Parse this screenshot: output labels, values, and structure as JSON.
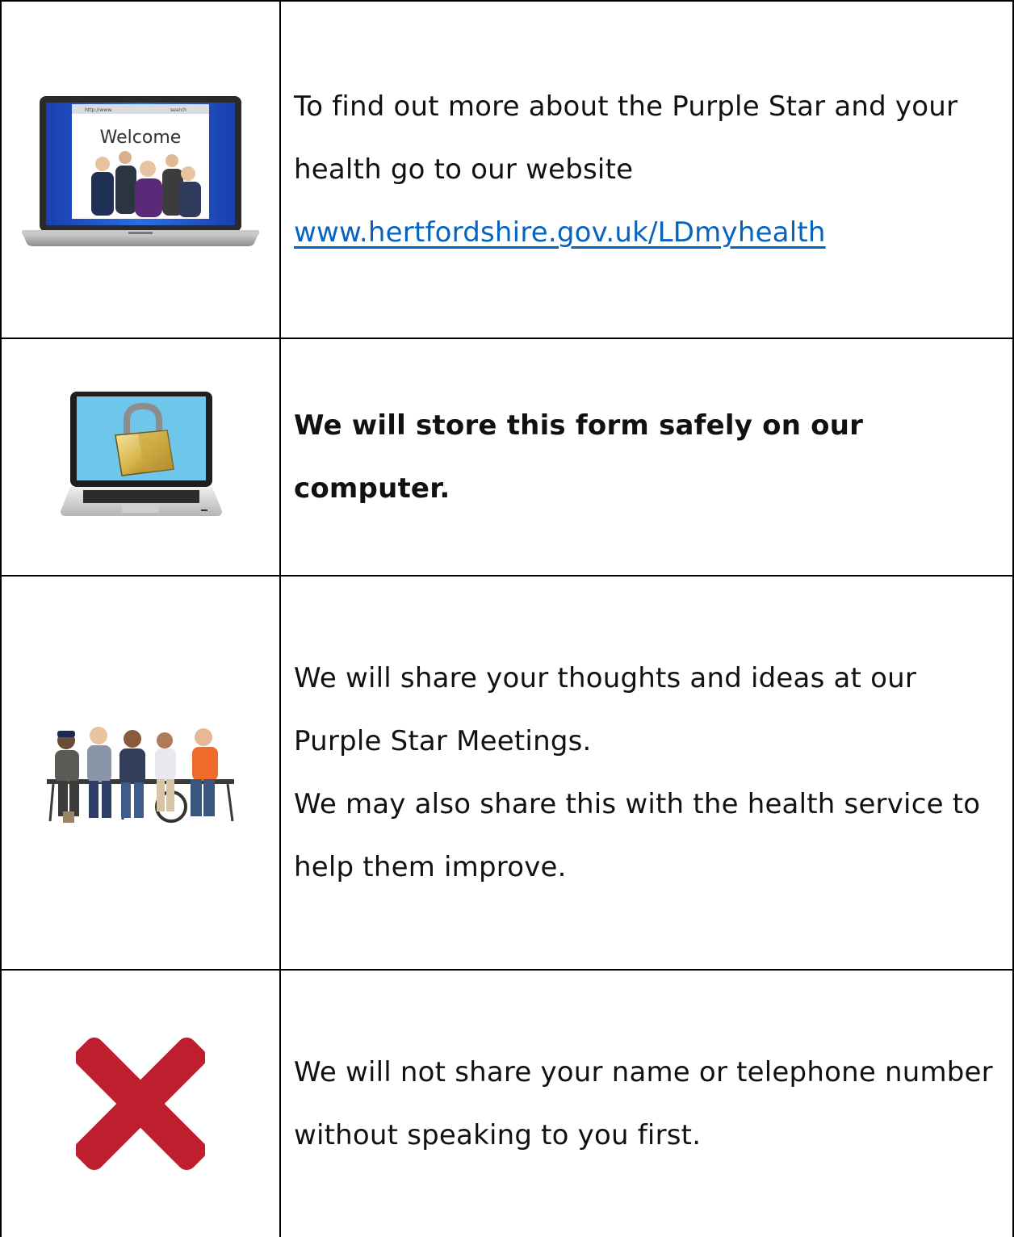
{
  "rows": [
    {
      "icon": "laptop-welcome-website-icon",
      "lines": [
        "To find out more about the Purple Star and your",
        "health go to our website"
      ],
      "link": "www.hertfordshire.gov.uk/LDmyhealth",
      "screen": {
        "url": "http://www.",
        "search": "search",
        "welcome": "Welcome"
      }
    },
    {
      "icon": "laptop-padlock-icon",
      "lines": [
        "We will store this form safely on our",
        "computer."
      ]
    },
    {
      "icon": "group-meeting-icon",
      "lines": [
        "We will share your thoughts and ideas at our",
        "Purple Star Meetings.",
        "We may also share this with the health service to",
        "help them improve."
      ]
    },
    {
      "icon": "red-cross-icon",
      "lines": [
        "We will not share your name or telephone number",
        "without speaking to you first."
      ]
    }
  ],
  "colors": {
    "border": "#000000",
    "link": "#0563c1",
    "cross": "#be1e2d"
  }
}
